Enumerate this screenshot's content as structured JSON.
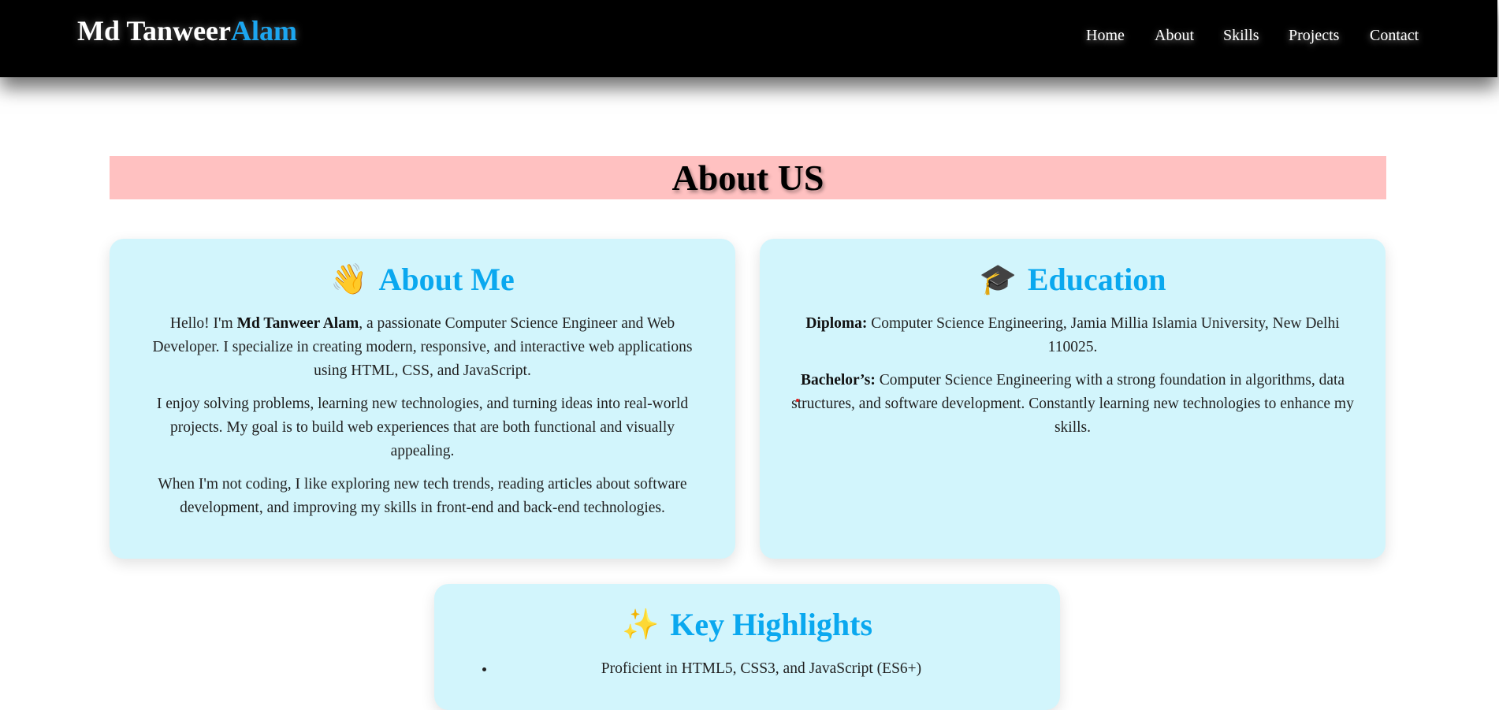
{
  "navbar": {
    "brand_first": "Md Tanweer",
    "brand_accent": "Alam",
    "links": [
      "Home",
      "About",
      "Skills",
      "Projects",
      "Contact"
    ]
  },
  "banner": {
    "title": "About US"
  },
  "about_me": {
    "emoji": "👋",
    "title": "About Me",
    "p1_pre": "Hello! I'm ",
    "p1_name": "Md Tanweer Alam",
    "p1_post": ", a passionate Computer Science Engineer and Web Developer. I specialize in creating modern, responsive, and interactive web applications using HTML, CSS, and JavaScript.",
    "p2": "I enjoy solving problems, learning new technologies, and turning ideas into real-world projects. My goal is to build web experiences that are both functional and visually appealing.",
    "p3": "When I'm not coding, I like exploring new tech trends, reading articles about software development, and improving my skills in front-end and back-end technologies."
  },
  "education": {
    "emoji": "🎓",
    "title": "Education",
    "diploma_label": "Diploma:",
    "diploma_text": " Computer Science Engineering, Jamia Millia Islamia University, New Delhi 110025.",
    "bachelor_label": "Bachelor’s:",
    "bachelor_text": " Computer Science Engineering with a strong foundation in algorithms, data structures, and software development. Constantly learning new technologies to enhance my skills."
  },
  "highlights": {
    "emoji": "✨",
    "title": "Key Highlights",
    "items": [
      "Proficient in HTML5, CSS3, and JavaScript (ES6+)"
    ]
  },
  "colors": {
    "navbar_bg": "#000000",
    "brand_accent": "#1ca6f0",
    "banner_bg": "#ffc1c1",
    "card_bg": "#d2f5fc",
    "heading_blue": "#0aa8ef"
  }
}
